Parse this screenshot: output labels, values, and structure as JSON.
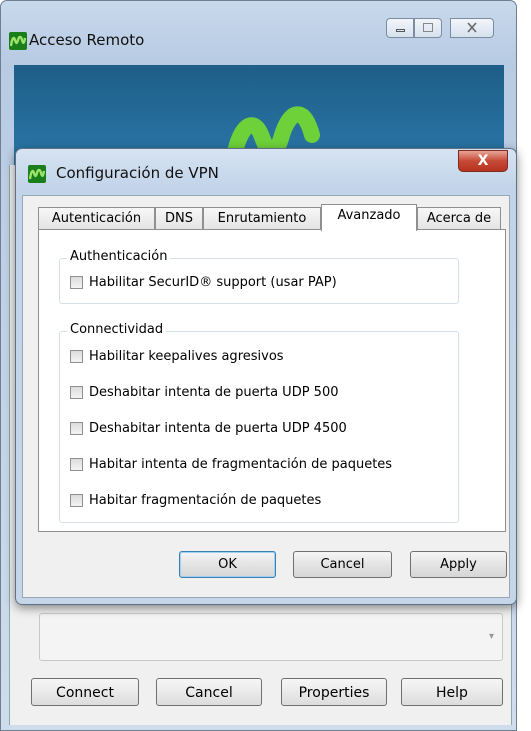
{
  "background_window": {
    "title": "Acceso Remoto",
    "buttons": [
      "Connect",
      "Cancel",
      "Properties",
      "Help"
    ],
    "combo_arrow": "▾"
  },
  "dialog": {
    "title": "Configuración de VPN",
    "close_glyph": "X",
    "tabs": [
      "Autenticación",
      "DNS",
      "Enrutamiento",
      "Avanzado",
      "Acerca de"
    ],
    "active_tab": "Avanzado",
    "groups": [
      {
        "label": "Authenticación",
        "options": [
          {
            "label": "Habilitar SecurID® support (usar PAP)",
            "checked": false
          }
        ]
      },
      {
        "label": "Connectividad",
        "options": [
          {
            "label": "Habilitar keepalives agresivos",
            "checked": false
          },
          {
            "label": "Deshabitar intenta de puerta UDP 500",
            "checked": false
          },
          {
            "label": "Deshabitar intenta de puerta UDP 4500",
            "checked": false
          },
          {
            "label": "Habitar intenta de fragmentación de paquetes",
            "checked": false
          },
          {
            "label": "Habitar fragmentación de paquetes",
            "checked": false
          }
        ]
      }
    ],
    "buttons": {
      "ok": "OK",
      "cancel": "Cancel",
      "apply": "Apply"
    }
  },
  "colors": {
    "accent": "#1a7e1a",
    "close_red": "#c64a36",
    "banner_blue": "#1e5e88"
  },
  "icons": [
    "movistar-logo-icon",
    "minimize-icon",
    "maximize-icon",
    "close-icon",
    "dropdown-arrow-icon"
  ]
}
